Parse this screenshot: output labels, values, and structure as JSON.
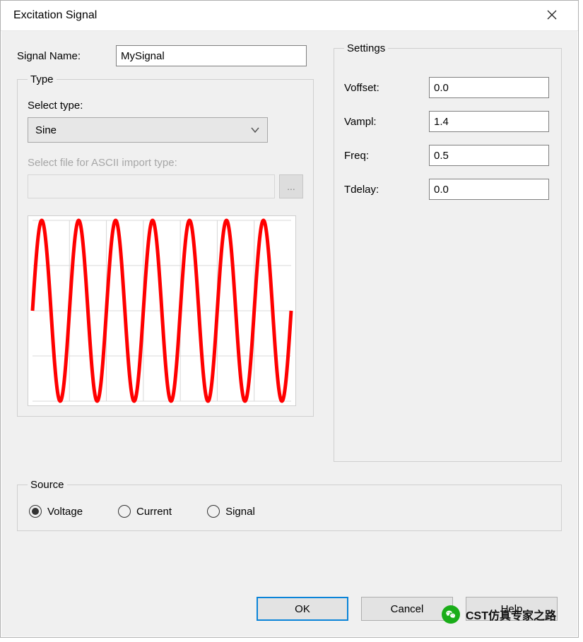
{
  "window": {
    "title": "Excitation Signal",
    "close_icon": "close-icon"
  },
  "signal_name": {
    "label": "Signal Name:",
    "value": "MySignal"
  },
  "type": {
    "legend": "Type",
    "select_label": "Select type:",
    "selected": "Sine",
    "ascii_label": "Select file for ASCII import type:",
    "ascii_value": "",
    "browse_label": "..."
  },
  "settings": {
    "legend": "Settings",
    "fields": [
      {
        "label": "Voffset:",
        "value": "0.0"
      },
      {
        "label": "Vampl:",
        "value": "1.4"
      },
      {
        "label": "Freq:",
        "value": "0.5"
      },
      {
        "label": "Tdelay:",
        "value": "0.0"
      }
    ]
  },
  "source": {
    "legend": "Source",
    "options": [
      {
        "label": "Voltage",
        "checked": true
      },
      {
        "label": "Current",
        "checked": false
      },
      {
        "label": "Signal",
        "checked": false
      }
    ]
  },
  "buttons": {
    "ok": "OK",
    "cancel": "Cancel",
    "help": "Help"
  },
  "watermark": "CST仿真专家之路",
  "chart_data": {
    "type": "line",
    "title": "",
    "xlabel": "",
    "ylabel": "",
    "xlim": [
      0,
      14
    ],
    "ylim": [
      -1.4,
      1.4
    ],
    "x": [
      0,
      0.25,
      0.5,
      0.75,
      1,
      1.25,
      1.5,
      1.75,
      2,
      2.25,
      2.5,
      2.75,
      3,
      3.25,
      3.5,
      3.75,
      4,
      4.25,
      4.5,
      4.75,
      5,
      5.25,
      5.5,
      5.75,
      6,
      6.25,
      6.5,
      6.75,
      7,
      7.25,
      7.5,
      7.75,
      8,
      8.25,
      8.5,
      8.75,
      9,
      9.25,
      9.5,
      9.75,
      10,
      10.25,
      10.5,
      10.75,
      11,
      11.25,
      11.5,
      11.75,
      12,
      12.25,
      12.5,
      12.75,
      13,
      13.25,
      13.5,
      13.75,
      14
    ],
    "y": [
      0,
      0.99,
      1.4,
      0.99,
      0,
      -0.99,
      -1.4,
      -0.99,
      0,
      0.99,
      1.4,
      0.99,
      0,
      -0.99,
      -1.4,
      -0.99,
      0,
      0.99,
      1.4,
      0.99,
      0,
      -0.99,
      -1.4,
      -0.99,
      0,
      0.99,
      1.4,
      0.99,
      0,
      -0.99,
      -1.4,
      -0.99,
      0,
      0.99,
      1.4,
      0.99,
      0,
      -0.99,
      -1.4,
      -0.99,
      0,
      0.99,
      1.4,
      0.99,
      0,
      -0.99,
      -1.4,
      -0.99,
      0,
      0.99,
      1.4,
      0.99,
      0,
      -0.99,
      -1.4,
      -0.99,
      0
    ]
  }
}
